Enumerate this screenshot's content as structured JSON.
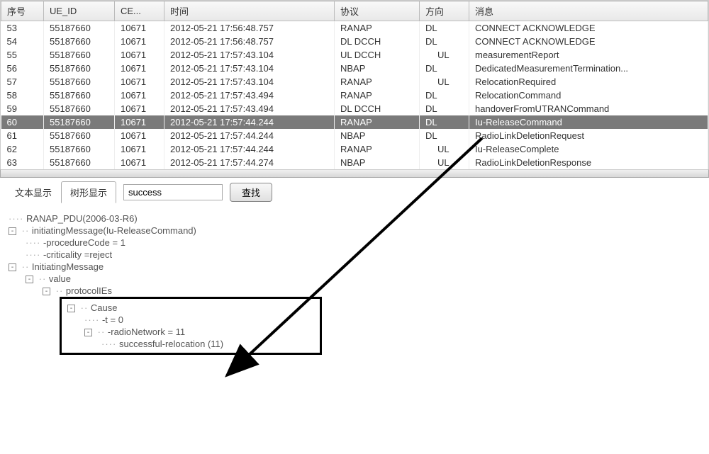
{
  "table": {
    "headers": {
      "seq": "序号",
      "ue_id": "UE_ID",
      "ce": "CE...",
      "time": "时间",
      "protocol": "协议",
      "direction": "方向",
      "message": "消息"
    },
    "rows": [
      {
        "seq": "53",
        "ue_id": "55187660",
        "ce": "10671",
        "time": "2012-05-21 17:56:48.757",
        "protocol": "RANAP",
        "direction": "DL",
        "message": "CONNECT ACKNOWLEDGE"
      },
      {
        "seq": "54",
        "ue_id": "55187660",
        "ce": "10671",
        "time": "2012-05-21 17:56:48.757",
        "protocol": "DL DCCH",
        "direction": "DL",
        "message": "CONNECT ACKNOWLEDGE"
      },
      {
        "seq": "55",
        "ue_id": "55187660",
        "ce": "10671",
        "time": "2012-05-21 17:57:43.104",
        "protocol": "UL DCCH",
        "direction": "UL",
        "message": "measurementReport"
      },
      {
        "seq": "56",
        "ue_id": "55187660",
        "ce": "10671",
        "time": "2012-05-21 17:57:43.104",
        "protocol": "NBAP",
        "direction": "DL",
        "message": "DedicatedMeasurementTermination..."
      },
      {
        "seq": "57",
        "ue_id": "55187660",
        "ce": "10671",
        "time": "2012-05-21 17:57:43.104",
        "protocol": "RANAP",
        "direction": "UL",
        "message": "RelocationRequired"
      },
      {
        "seq": "58",
        "ue_id": "55187660",
        "ce": "10671",
        "time": "2012-05-21 17:57:43.494",
        "protocol": "RANAP",
        "direction": "DL",
        "message": "RelocationCommand"
      },
      {
        "seq": "59",
        "ue_id": "55187660",
        "ce": "10671",
        "time": "2012-05-21 17:57:43.494",
        "protocol": "DL DCCH",
        "direction": "DL",
        "message": "handoverFromUTRANCommand"
      },
      {
        "seq": "60",
        "ue_id": "55187660",
        "ce": "10671",
        "time": "2012-05-21 17:57:44.244",
        "protocol": "RANAP",
        "direction": "DL",
        "message": "Iu-ReleaseCommand",
        "selected": true
      },
      {
        "seq": "61",
        "ue_id": "55187660",
        "ce": "10671",
        "time": "2012-05-21 17:57:44.244",
        "protocol": "NBAP",
        "direction": "DL",
        "message": "RadioLinkDeletionRequest"
      },
      {
        "seq": "62",
        "ue_id": "55187660",
        "ce": "10671",
        "time": "2012-05-21 17:57:44.244",
        "protocol": "RANAP",
        "direction": "UL",
        "message": "Iu-ReleaseComplete"
      },
      {
        "seq": "63",
        "ue_id": "55187660",
        "ce": "10671",
        "time": "2012-05-21 17:57:44.274",
        "protocol": "NBAP",
        "direction": "UL",
        "message": "RadioLinkDeletionResponse"
      }
    ]
  },
  "toolbar": {
    "tab_text": "文本显示",
    "tab_tree": "树形显示",
    "search_value": "success",
    "search_button": "查找"
  },
  "tree": {
    "root": "RANAP_PDU(2006-03-R6)",
    "initiating_message": "initiatingMessage(Iu-ReleaseCommand)",
    "procedure_code": "-procedureCode = 1",
    "criticality": "-criticality =reject",
    "initiating_message2": "InitiatingMessage",
    "value": "value",
    "protocol_ies": "protocolIEs",
    "cause": "Cause",
    "t_value": "-t = 0",
    "radio_network": "-radioNetwork = 11",
    "successful_relocation": "successful-relocation (11)"
  }
}
